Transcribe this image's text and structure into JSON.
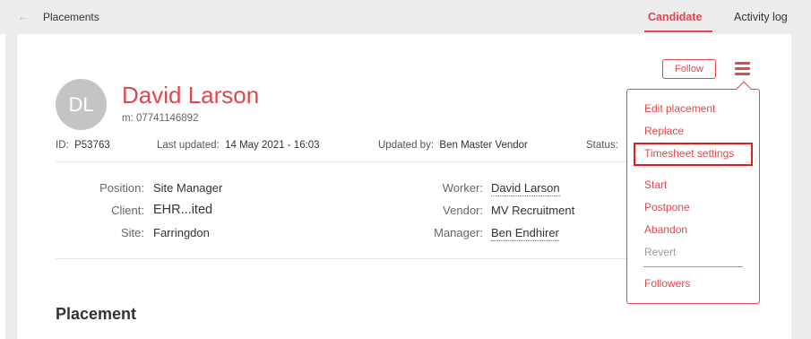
{
  "topbar": {
    "breadcrumb": "Placements",
    "tabs": [
      {
        "label": "Candidate",
        "active": true
      },
      {
        "label": "Activity log",
        "active": false
      }
    ]
  },
  "header": {
    "follow_label": "Follow",
    "avatar_initials": "DL",
    "name": "David Larson",
    "mobile": "m: 07741146892"
  },
  "meta": {
    "id_label": "ID:",
    "id_value": "P53763",
    "updated_label": "Last updated:",
    "updated_value": "14 May 2021 - 16:03",
    "updated_by_label": "Updated by:",
    "updated_by_value": "Ben Master Vendor",
    "status_label": "Status:"
  },
  "details": {
    "left": [
      {
        "label": "Position:",
        "value": "Site Manager"
      },
      {
        "label": "Client:",
        "value": "EHR...ited"
      },
      {
        "label": "Site:",
        "value": "Farringdon"
      }
    ],
    "right": [
      {
        "label": "Worker:",
        "value": "David Larson"
      },
      {
        "label": "Vendor:",
        "value": "MV Recruitment"
      },
      {
        "label": "Manager:",
        "value": "Ben Endhirer"
      }
    ]
  },
  "section_title": "Placement",
  "menu": {
    "items": [
      {
        "label": "Edit placement",
        "enabled": true
      },
      {
        "label": "Replace",
        "enabled": true
      },
      {
        "label": "Timesheet settings",
        "enabled": true,
        "highlighted": true
      },
      {
        "label": "Start",
        "enabled": true
      },
      {
        "label": "Postpone",
        "enabled": true
      },
      {
        "label": "Abandon",
        "enabled": true
      },
      {
        "label": "Revert",
        "enabled": false
      },
      {
        "label": "Followers",
        "enabled": true
      }
    ]
  },
  "colors": {
    "accent": "#e0474c",
    "highlight": "#e21c1c",
    "background": "#ececec"
  }
}
